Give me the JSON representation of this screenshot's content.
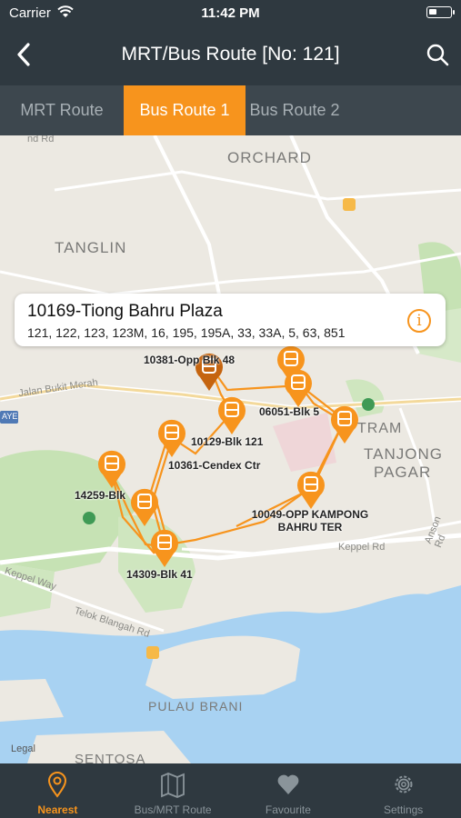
{
  "status_bar": {
    "carrier": "Carrier",
    "time": "11:42 PM"
  },
  "navbar": {
    "title": "MRT/Bus Route [No: 121]",
    "back_icon": "chevron-left-icon",
    "search_icon": "search-icon"
  },
  "tabs": [
    {
      "label": "MRT Route",
      "selected": false
    },
    {
      "label": "Bus Route 1",
      "selected": true
    },
    {
      "label": "Bus Route 2",
      "selected": false
    }
  ],
  "colors": {
    "accent": "#f7941d",
    "bar": "#2f3940",
    "route": "#f7941d",
    "selected_marker": "#c5640f"
  },
  "map": {
    "area_labels": [
      "ORCHARD",
      "TANGLIN",
      "TANJONG",
      "PAGAR",
      "PULAU BRANI",
      "SENTOSA"
    ],
    "road_labels": [
      "Jalan Bukit Merah",
      "Keppel Rd",
      "Keppel Way",
      "Telok Blangah Rd",
      "Anson Rd",
      "nd Rd",
      "AYE"
    ],
    "stop_labels": [
      "10381-Opp Blk 48",
      "06051-Blk 5",
      "10129-Blk 121",
      "10361-Cendex Ctr",
      "14259-Blk",
      "10049-OPP KAMPONG BAHRU TER",
      "14309-Blk 41",
      "TRAM"
    ],
    "legal": "Legal",
    "callout": {
      "title": "10169-Tiong Bahru Plaza",
      "services": "121, 122, 123, 123M, 16, 195, 195A, 33, 33A, 5, 63, 851",
      "info_icon": "info-icon"
    }
  },
  "tab_bar": [
    {
      "label": "Nearest",
      "icon": "location-pin-icon",
      "active": true
    },
    {
      "label": "Bus/MRT Route",
      "icon": "map-icon",
      "active": false
    },
    {
      "label": "Favourite",
      "icon": "heart-icon",
      "active": false
    },
    {
      "label": "Settings",
      "icon": "gear-icon",
      "active": false
    }
  ]
}
